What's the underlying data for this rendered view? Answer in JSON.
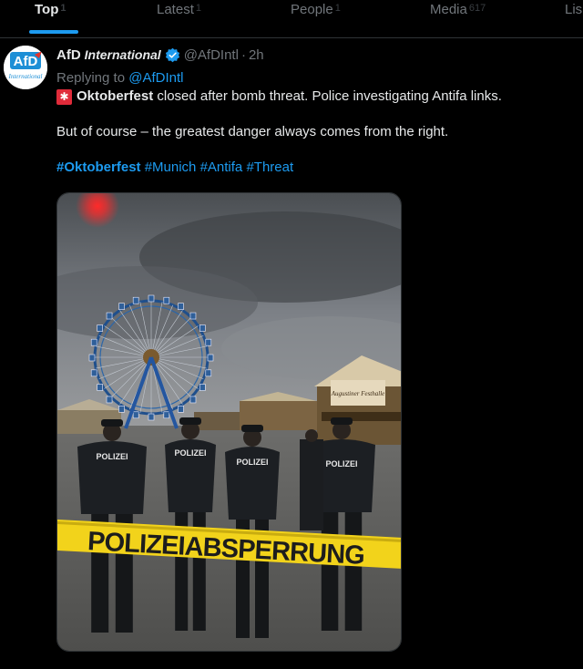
{
  "tabs": [
    {
      "label": "Top",
      "count": "1",
      "active": true
    },
    {
      "label": "Latest",
      "count": "1",
      "active": false
    },
    {
      "label": "People",
      "count": "1",
      "active": false
    },
    {
      "label": "Media",
      "count": "617",
      "active": false
    },
    {
      "label": "Lis",
      "count": "",
      "active": false
    }
  ],
  "post": {
    "avatar_text_top": "AfD",
    "avatar_text_bottom": "International",
    "author_name": "AfD",
    "author_name_suffix": "International",
    "handle": "@AfDIntl",
    "separator": "·",
    "time": "2h",
    "replying_prefix": "Replying to ",
    "replying_handle": "@AfDIntl",
    "line1_bold": "Oktoberfest",
    "line1_rest": " closed after bomb threat. Police investigating Antifa links.",
    "line2": "But of course – the greatest danger always comes from the right.",
    "hashtags": [
      "#Oktoberfest",
      "#Munich",
      "#Antifa",
      "#Threat"
    ]
  },
  "image": {
    "police_labels": [
      "POLIZEI",
      "POLIZEI",
      "POLIZEI",
      "POLIZEI"
    ],
    "tape_text": "POLIZEIABSPERRUNG",
    "sign_text": "Augustiner Festhalle"
  },
  "colors": {
    "accent": "#1d9bf0",
    "tape": "#f2d31b",
    "siren": "#e02b3a"
  }
}
